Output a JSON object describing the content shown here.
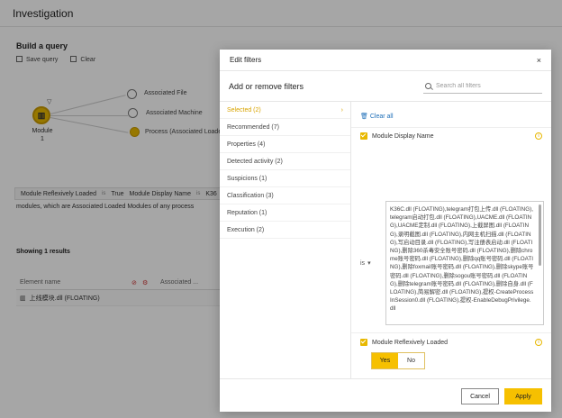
{
  "page": {
    "title": "Investigation",
    "query_title": "Build a query",
    "save_query": "Save query",
    "clear": "Clear",
    "main_node_label": "Module",
    "main_node_count": "1",
    "children": [
      "Associated File",
      "Associated Machine",
      "Process (Associated Loade"
    ],
    "chips": {
      "chip1_label": "Module Reflexively Loaded",
      "chip1_op": "is",
      "chip1_value": "True",
      "chip2_label": "Module Display Name",
      "chip2_op": "is",
      "chip2_value": "K36"
    },
    "description": "modules, which are Associated Loaded Modules of any process",
    "results": "Showing 1 results",
    "col_element_name": "Element name",
    "col_associated": "Associated ...",
    "row_value": "上线模块.dll (FLOATING)"
  },
  "modal": {
    "title": "Edit filters",
    "close": "×",
    "sub_title": "Add or remove filters",
    "search_placeholder": "Search all filters",
    "categories": [
      {
        "label": "Selected (2)"
      },
      {
        "label": "Recommended (7)"
      },
      {
        "label": "Properties (4)"
      },
      {
        "label": "Detected activity (2)"
      },
      {
        "label": "Suspicions (1)"
      },
      {
        "label": "Classification (3)"
      },
      {
        "label": "Reputation (1)"
      },
      {
        "label": "Execution (2)"
      }
    ],
    "clear_all": "Clear all",
    "filter1": {
      "label": "Module Display Name",
      "operator": "is",
      "value": "K36C.dll (FLOATING),telegram打包上传.dll (FLOATING),telegram启动打包.dll (FLOATING),UACME.dll (FLOATING),UACME定制.dll (FLOATING),上截屏图.dll (FLOATING),录明截图.dll (FLOATING),内网主机扫描.dll (FLOATING),写启动目录.dll (FLOATING),写注册表启动.dll (FLOATING),删除360杀毒安全账号密码.dll (FLOATING),删除chrome账号密码.dll (FLOATING),删除qq账号密码.dll (FLOATING),删除foxmail账号密码.dll (FLOATING),删除skype账号密码.dll (FLOATING),删除sogou账号密码.dll (FLOATING),删除telegram账号密码.dll (FLOATING),删除自身.dll (FLOATING),简易解密.dll (FLOATING),提权-CreateProcessInSession0.dll (FLOATING),提权-EnableDebugPrivilege.dll"
    },
    "filter2": {
      "label": "Module Reflexively Loaded",
      "yes": "Yes",
      "no": "No"
    },
    "cancel": "Cancel",
    "apply": "Apply"
  }
}
